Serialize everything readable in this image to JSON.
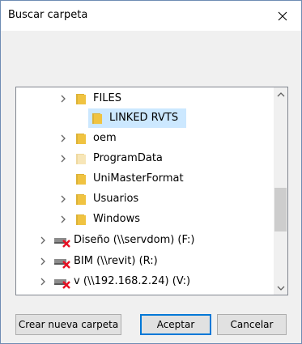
{
  "dialog": {
    "title": "Buscar carpeta"
  },
  "tree": {
    "items": [
      {
        "label": "FILES",
        "icon": "folder-icon",
        "expandable": true,
        "selected": false
      },
      {
        "label": "LINKED RVTS",
        "icon": "folder-icon",
        "expandable": false,
        "selected": true
      },
      {
        "label": "oem",
        "icon": "folder-icon",
        "expandable": true,
        "selected": false
      },
      {
        "label": "ProgramData",
        "icon": "folder-icon",
        "expandable": true,
        "selected": false
      },
      {
        "label": "UniMasterFormat",
        "icon": "folder-icon",
        "expandable": false,
        "selected": false
      },
      {
        "label": "Usuarios",
        "icon": "folder-icon",
        "expandable": true,
        "selected": false
      },
      {
        "label": "Windows",
        "icon": "folder-icon",
        "expandable": true,
        "selected": false
      },
      {
        "label": "Diseño (\\\\servdom) (F:)",
        "icon": "disconnected-network-drive-icon",
        "expandable": true,
        "selected": false
      },
      {
        "label": "BIM (\\\\revit) (R:)",
        "icon": "disconnected-network-drive-icon",
        "expandable": true,
        "selected": false
      },
      {
        "label": "v (\\\\192.168.2.24) (V:)",
        "icon": "disconnected-network-drive-icon",
        "expandable": true,
        "selected": false
      }
    ]
  },
  "buttons": {
    "new_folder": "Crear nueva carpeta",
    "accept": "Aceptar",
    "cancel": "Cancelar"
  },
  "colors": {
    "accent": "#0078d7",
    "selection": "#cce8ff",
    "folder": "#f0c341",
    "drive_error": "#e81123"
  }
}
